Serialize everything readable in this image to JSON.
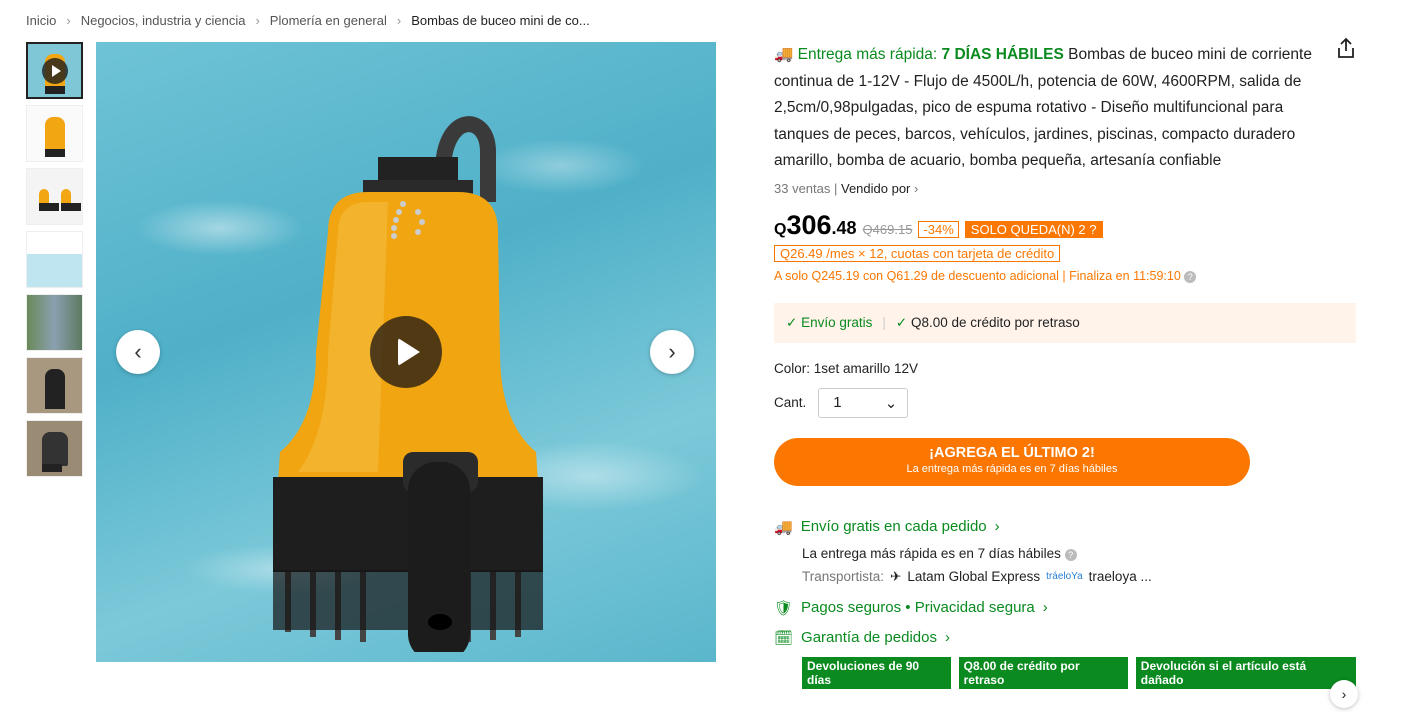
{
  "breadcrumb": [
    "Inicio",
    "Negocios, industria y ciencia",
    "Plomería en general",
    "Bombas de buceo mini de co..."
  ],
  "product": {
    "fast_label": "Entrega más rápida:",
    "fast_days": "7 DÍAS HÁBILES",
    "title": "Bombas de buceo mini de corriente continua de 1-12V - Flujo de 4500L/h, potencia de 60W, 4600RPM, salida de 2,5cm/0,98pulgadas, pico de espuma rotativo - Diseño multifuncional para tanques de peces, barcos, vehículos, jardines, piscinas, compacto duradero amarillo, bomba de acuario, bomba pequeña, artesanía confiable",
    "sold": "33 ventas",
    "sold_by": "Vendido por"
  },
  "price": {
    "currency": "Q",
    "int": "306",
    "dec": ".48",
    "old": "Q469.15",
    "discount": "-34%",
    "left": "SOLO QUEDA(N) 2",
    "installments": "Q26.49 /mes × 12, cuotas con tarjeta de crédito",
    "promo": "A solo Q245.19 con Q61.29 de descuento adicional",
    "ends": "Finaliza en 11:59:10"
  },
  "benefits": {
    "free_ship": "Envío gratis",
    "credit": "Q8.00 de crédito por retraso"
  },
  "options": {
    "color_label": "Color: 1set amarillo 12V",
    "qty_label": "Cant.",
    "qty": "1"
  },
  "cta": {
    "label": "¡AGREGA EL ÚLTIMO 2!",
    "sub": "La entrega más rápida es en 7 días hábiles"
  },
  "shipping": {
    "title": "Envío gratis en cada pedido",
    "fastest": "La entrega más rápida es en 7 días hábiles",
    "carrier_label": "Transportista:",
    "carrier1": "Latam Global Express",
    "carrier2": "traeloya ..."
  },
  "secure": "Pagos seguros • Privacidad segura",
  "guarantee": {
    "title": "Garantía de pedidos",
    "tags": [
      "Devoluciones de 90 días",
      "Q8.00 de crédito por retraso",
      "Devolución si el artículo está dañado"
    ]
  },
  "colors": {
    "accent": "#fb7701",
    "green": "#0a8a1f"
  }
}
